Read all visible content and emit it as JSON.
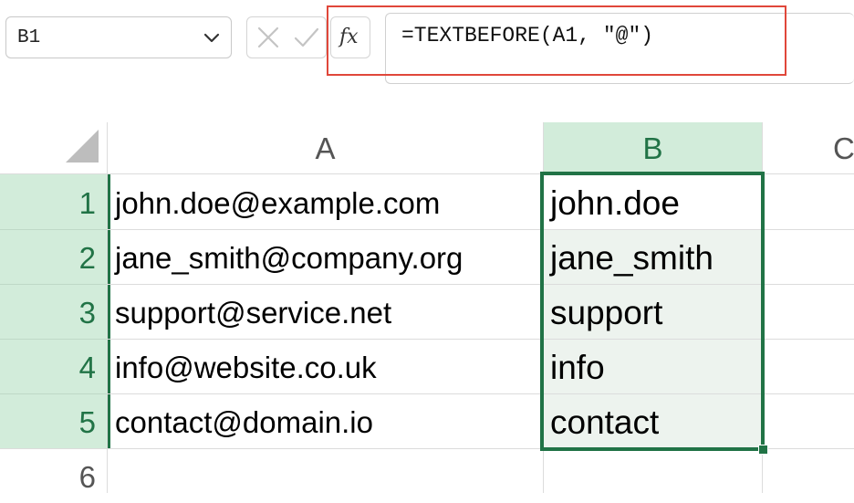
{
  "name_box": {
    "value": "B1"
  },
  "formula_bar": {
    "formula": "=TEXTBEFORE(A1, \"@\")",
    "fx_label": "fx"
  },
  "columns": [
    "A",
    "B",
    "C"
  ],
  "rows": [
    {
      "number": "1",
      "a": "john.doe@example.com",
      "b": "john.doe"
    },
    {
      "number": "2",
      "a": "jane_smith@company.org",
      "b": "jane_smith"
    },
    {
      "number": "3",
      "a": "support@service.net",
      "b": "support"
    },
    {
      "number": "4",
      "a": "info@website.co.uk",
      "b": "info"
    },
    {
      "number": "5",
      "a": "contact@domain.io",
      "b": "contact"
    },
    {
      "number": "6",
      "a": "",
      "b": ""
    }
  ],
  "colors": {
    "selection_green": "#217346",
    "header_selected_bg": "#d2ecda",
    "range_fill": "#edf3ee",
    "highlight_red": "#e0473a"
  }
}
